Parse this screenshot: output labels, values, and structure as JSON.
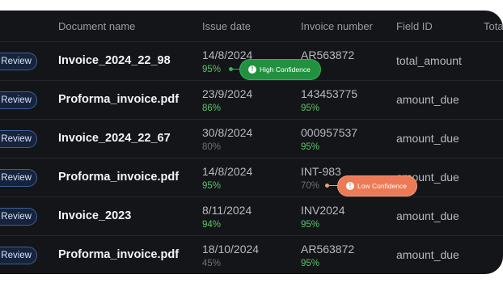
{
  "columns": [
    "Document name",
    "Issue date",
    "Invoice number",
    "Field ID",
    "Tota"
  ],
  "review_label": "Review",
  "rows": [
    {
      "name": "Invoice_2024_22_98",
      "date": "14/8/2024",
      "date_conf": "95%",
      "date_level": "high",
      "invoice": "AR563872",
      "invoice_conf": "",
      "invoice_level": "high",
      "field": "total_amount"
    },
    {
      "name": "Proforma_invoice.pdf",
      "date": "23/9/2024",
      "date_conf": "86%",
      "date_level": "high",
      "invoice": "143453775",
      "invoice_conf": "95%",
      "invoice_level": "high",
      "field": "amount_due"
    },
    {
      "name": "Invoice_2024_22_67",
      "date": "30/8/2024",
      "date_conf": "80%",
      "date_level": "low",
      "invoice": "000957537",
      "invoice_conf": "95%",
      "invoice_level": "high",
      "field": "amount_due"
    },
    {
      "name": "Proforma_invoice.pdf",
      "date": "14/8/2024",
      "date_conf": "95%",
      "date_level": "high",
      "invoice": "INT-983",
      "invoice_conf": "70%",
      "invoice_level": "low",
      "field": "amount_due"
    },
    {
      "name": "Invoice_2023",
      "date": "8/11/2024",
      "date_conf": "94%",
      "date_level": "high",
      "invoice": "INV2024",
      "invoice_conf": "95%",
      "invoice_level": "high",
      "field": "amount_due"
    },
    {
      "name": "Proforma_invoice.pdf",
      "date": "18/10/2024",
      "date_conf": "45%",
      "date_level": "low",
      "invoice": "AR563872",
      "invoice_conf": "95%",
      "invoice_level": "high",
      "field": "amount_due"
    }
  ],
  "tooltips": {
    "high": {
      "label": "High Confidence",
      "icon": "exclamation-icon",
      "color": "#21913f"
    },
    "low": {
      "label": "Low Confidence",
      "icon": "exclamation-icon",
      "color": "#ec7a57"
    }
  }
}
